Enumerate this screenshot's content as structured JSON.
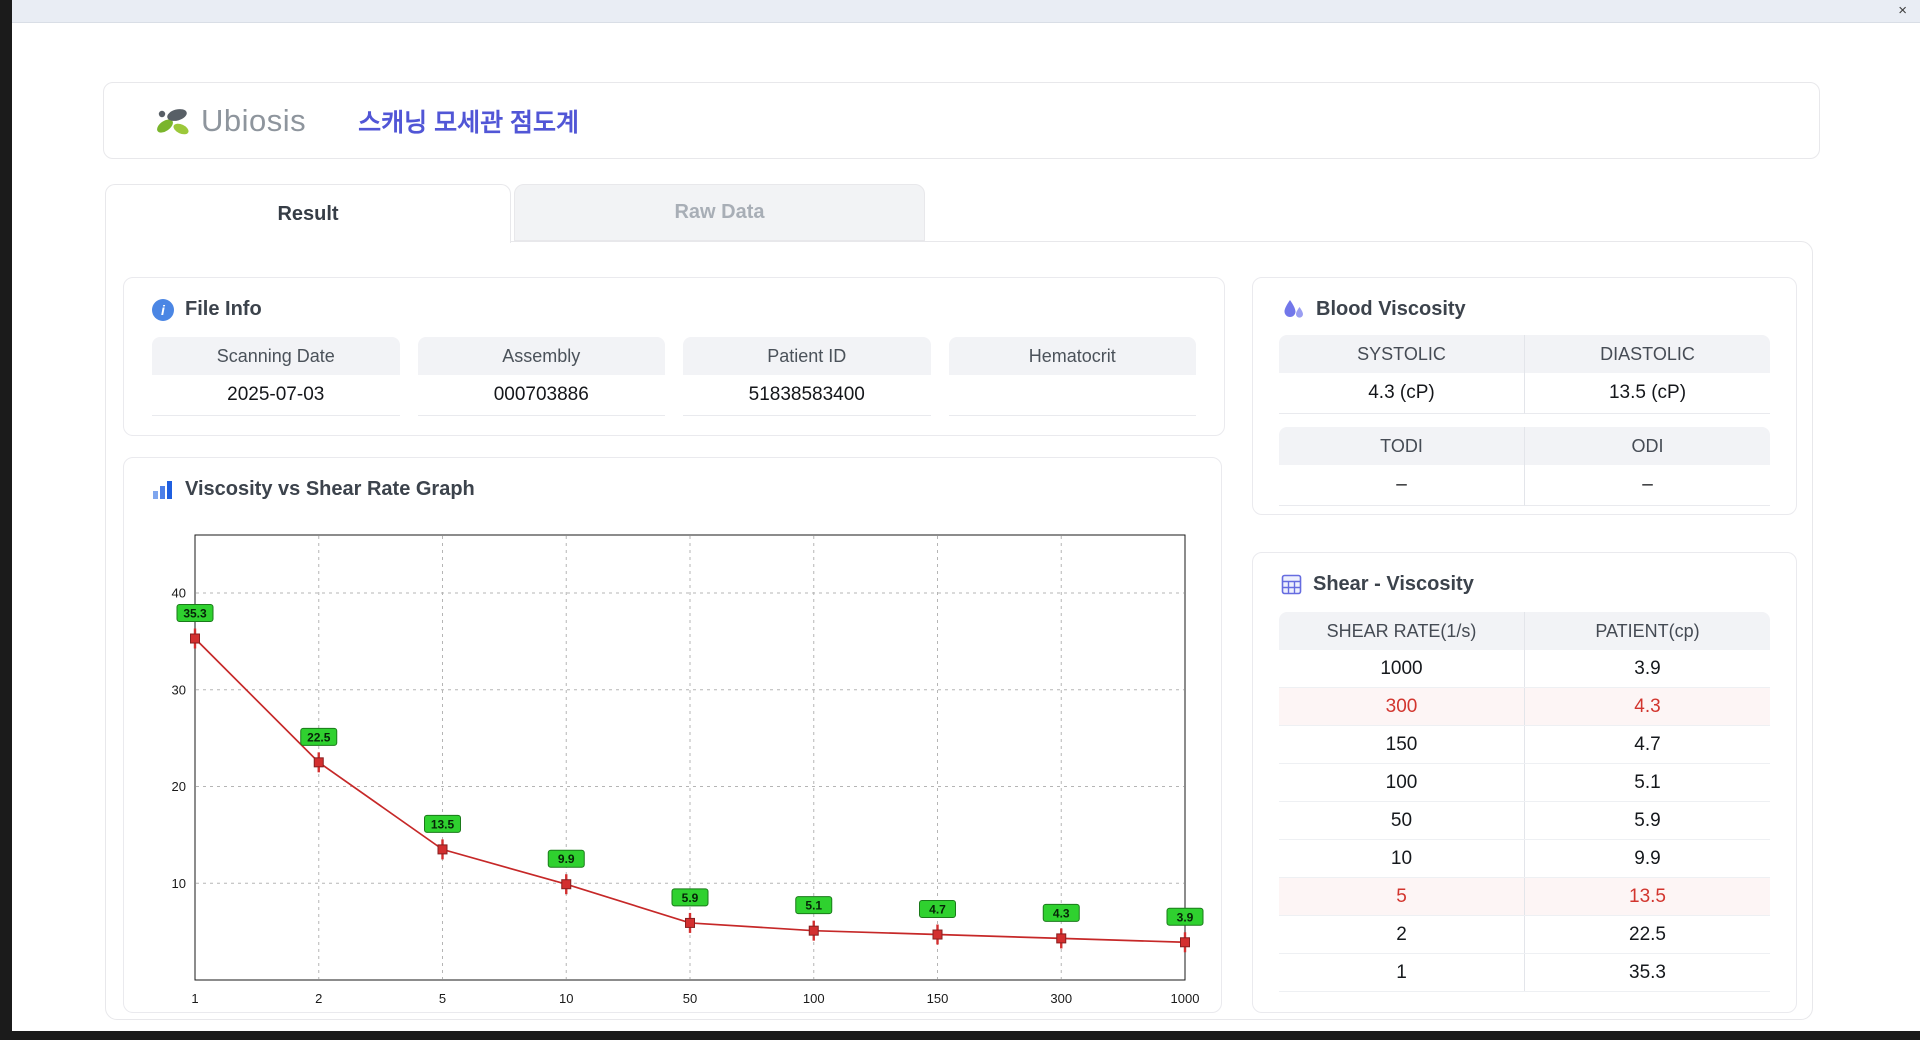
{
  "window": {
    "close_icon": "×"
  },
  "icons": {
    "info": "i"
  },
  "header": {
    "brand": "Ubiosis",
    "app_title": "스캐닝 모세관 점도계"
  },
  "tabs": {
    "result": "Result",
    "raw_data": "Raw Data"
  },
  "file_info": {
    "title": "File Info",
    "fields": [
      {
        "label": "Scanning Date",
        "value": "2025-07-03"
      },
      {
        "label": "Assembly",
        "value": "000703886"
      },
      {
        "label": "Patient ID",
        "value": "51838583400"
      },
      {
        "label": "Hematocrit",
        "value": ""
      }
    ]
  },
  "blood_viscosity": {
    "title": "Blood Viscosity",
    "groups": [
      {
        "headers": [
          "SYSTOLIC",
          "DIASTOLIC"
        ],
        "values": [
          "4.3 (cP)",
          "13.5 (cP)"
        ]
      },
      {
        "headers": [
          "TODI",
          "ODI"
        ],
        "values": [
          "–",
          "–"
        ]
      }
    ]
  },
  "graph": {
    "title": "Viscosity vs Shear Rate Graph"
  },
  "chart_data": {
    "type": "line",
    "title": "Viscosity vs Shear Rate Graph",
    "x_axis_type": "category",
    "x_categories": [
      "1",
      "2",
      "5",
      "10",
      "50",
      "100",
      "150",
      "300",
      "1000"
    ],
    "values": [
      35.3,
      22.5,
      13.5,
      9.9,
      5.9,
      5.1,
      4.7,
      4.3,
      3.9
    ],
    "point_labels": [
      "35.3",
      "22.5",
      "13.5",
      "9.9",
      "5.9",
      "5.1",
      "4.7",
      "4.3",
      "3.9"
    ],
    "xlabel": "",
    "ylabel": "",
    "ylim": [
      0,
      46
    ],
    "yticks": [
      10,
      20,
      30,
      40
    ],
    "grid": true,
    "legend": "none",
    "line_color": "#c62828",
    "marker_color": "#d32f2f",
    "label_bg": "#2fd12f",
    "label_border": "#1a7a1a"
  },
  "shear_viscosity": {
    "title": "Shear - Viscosity",
    "columns": [
      "SHEAR RATE(1/s)",
      "PATIENT(cp)"
    ],
    "rows": [
      {
        "shear_rate": "1000",
        "patient": "3.9",
        "highlight": false
      },
      {
        "shear_rate": "300",
        "patient": "4.3",
        "highlight": true
      },
      {
        "shear_rate": "150",
        "patient": "4.7",
        "highlight": false
      },
      {
        "shear_rate": "100",
        "patient": "5.1",
        "highlight": false
      },
      {
        "shear_rate": "50",
        "patient": "5.9",
        "highlight": false
      },
      {
        "shear_rate": "10",
        "patient": "9.9",
        "highlight": false
      },
      {
        "shear_rate": "5",
        "patient": "13.5",
        "highlight": true
      },
      {
        "shear_rate": "2",
        "patient": "22.5",
        "highlight": false
      },
      {
        "shear_rate": "1",
        "patient": "35.3",
        "highlight": false
      }
    ]
  },
  "colors": {
    "accent_blue": "#5156d6",
    "highlight_red": "#d2352e",
    "header_gray": "#f2f3f6",
    "chart_line_red": "#c62828",
    "point_label_green": "#2fd12f"
  }
}
